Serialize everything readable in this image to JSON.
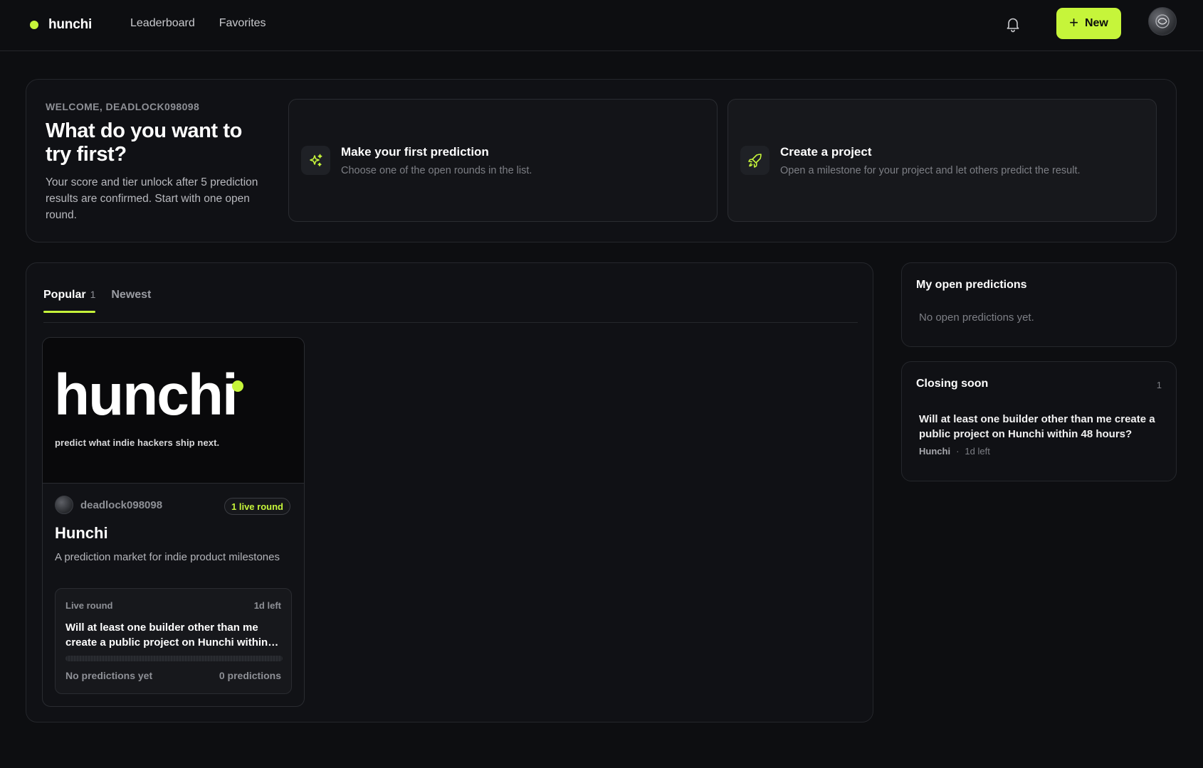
{
  "header": {
    "brand": "hunchi",
    "nav": [
      "Leaderboard",
      "Favorites"
    ],
    "new_label": "New",
    "colors": {
      "accent": "#c6f53a",
      "background": "#0d0e11"
    }
  },
  "welcome": {
    "label": "WELCOME, DEADLOCK098098",
    "title": "What do you want to try first?",
    "desc": "Your score and tier unlock after 5 prediction results are confirmed. Start with one open round.",
    "actions": [
      {
        "title": "Make your first prediction",
        "sub": "Choose one of the open rounds in the list.",
        "icon": "sparkles-icon"
      },
      {
        "title": "Create a project",
        "sub": "Open a milestone for your project and let others predict the result.",
        "icon": "rocket-icon"
      }
    ]
  },
  "tabs": [
    {
      "label": "Popular",
      "count": "1"
    },
    {
      "label": "Newest"
    }
  ],
  "project": {
    "banner_word": "hunchi",
    "banner_tagline": "predict what indie hackers ship next.",
    "owner": "deadlock098098",
    "badge": "1 live round",
    "title": "Hunchi",
    "desc": "A prediction market for indie product milestones",
    "round": {
      "label": "Live round",
      "time_left": "1d left",
      "question": "Will at least one builder other than me create a public project on Hunchi within 48 hours?",
      "status": "No predictions yet",
      "count": "0 predictions"
    }
  },
  "open_predictions": {
    "title": "My open predictions",
    "empty": "No open predictions yet."
  },
  "closing_soon": {
    "title": "Closing soon",
    "count": "1",
    "items": [
      {
        "question": "Will at least one builder other than me create a public project on Hunchi within 48 hours?",
        "project": "Hunchi",
        "sep": "·",
        "time_left": "1d left"
      }
    ]
  }
}
